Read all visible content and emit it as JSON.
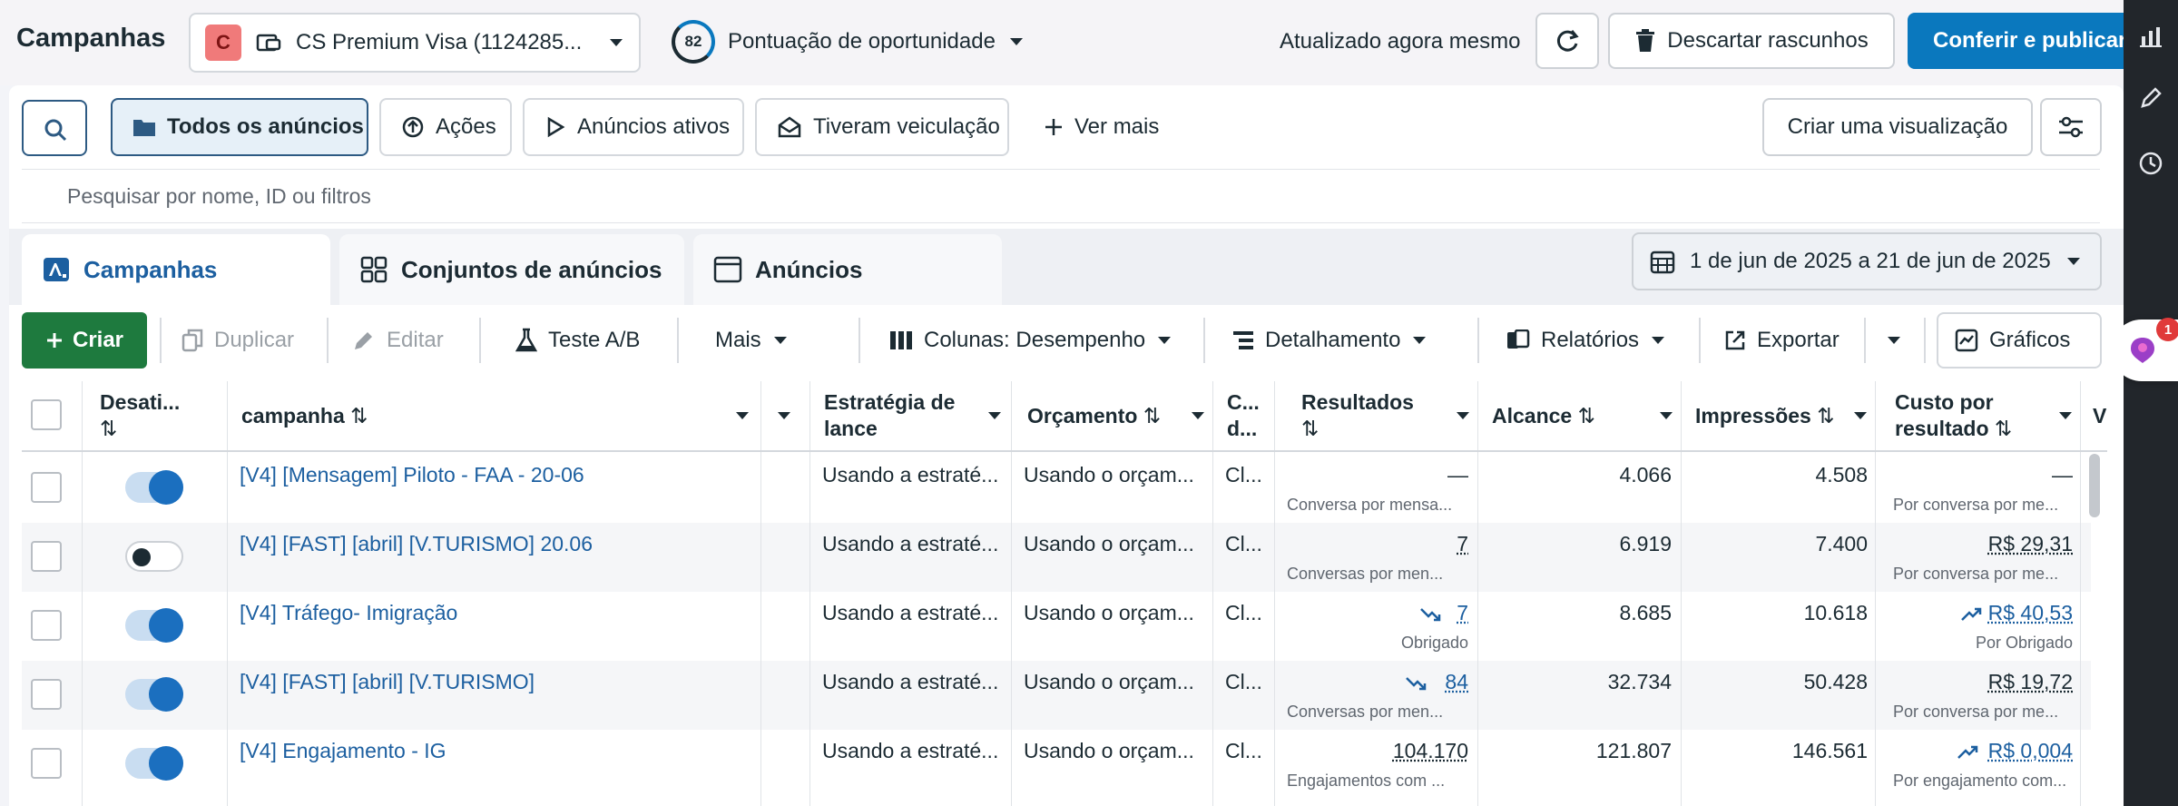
{
  "header": {
    "title": "Campanhas",
    "account": {
      "avatar_letter": "C",
      "name": "CS Premium Visa (1124285..."
    },
    "opportunity": {
      "score": "82",
      "label": "Pontuação de oportunidade"
    },
    "updated": "Atualizado agora mesmo",
    "discard_label": "Descartar rascunhos",
    "publish_label": "Conferir e publicar (",
    "rail_badge": "1"
  },
  "filters": {
    "chips": [
      "Todos os anúncios",
      "Ações",
      "Anúncios ativos",
      "Tiveram veiculação"
    ],
    "more": "Ver mais",
    "create_view": "Criar uma visualização",
    "search_placeholder": "Pesquisar por nome, ID ou filtros"
  },
  "tabs": [
    "Campanhas",
    "Conjuntos de anúncios",
    "Anúncios"
  ],
  "date_range": "1 de jun de 2025 a 21 de jun de 2025",
  "toolbar": {
    "create": "Criar",
    "duplicate": "Duplicar",
    "edit": "Editar",
    "ab_test": "Teste A/B",
    "more": "Mais",
    "columns": "Colunas: Desempenho",
    "breakdown": "Detalhamento",
    "reports": "Relatórios",
    "export": "Exportar",
    "charts": "Gráficos"
  },
  "table": {
    "headers": {
      "toggle": "Desati...",
      "name": "campanha",
      "bid": "Estratégia de lance",
      "budget": "Orçamento",
      "cd": "C... d...",
      "results": "Resultados",
      "reach": "Alcance",
      "impressions": "Impressões",
      "cost": "Custo por resultado",
      "next": "V"
    },
    "rows": [
      {
        "on": true,
        "name": "[V4] [Mensagem] Piloto - FAA - 20-06",
        "bid": "Usando a estraté...",
        "budget": "Usando o orçam...",
        "cd": "Cl...",
        "result": "—",
        "result_sub": "Conversa por mensa...",
        "reach": "4.066",
        "impressions": "4.508",
        "cost": "—",
        "cost_sub": "Por conversa por me..."
      },
      {
        "on": false,
        "name": "[V4] [FAST] [abril] [V.TURISMO] 20.06",
        "bid": "Usando a estraté...",
        "budget": "Usando o orçam...",
        "cd": "Cl...",
        "result": "7",
        "result_sub": "Conversas por men...",
        "reach": "6.919",
        "impressions": "7.400",
        "cost": "R$ 29,31",
        "cost_sub": "Por conversa por me..."
      },
      {
        "on": true,
        "name": "[V4] Tráfego- Imigração",
        "bid": "Usando a estraté...",
        "budget": "Usando o orçam...",
        "cd": "Cl...",
        "result": "7",
        "result_sub": "Obrigado",
        "reach": "8.685",
        "impressions": "10.618",
        "cost": "R$ 40,53",
        "cost_sub": "Por Obrigado"
      },
      {
        "on": true,
        "name": "[V4] [FAST] [abril] [V.TURISMO]",
        "bid": "Usando a estraté...",
        "budget": "Usando o orçam...",
        "cd": "Cl...",
        "result": "84",
        "result_sub": "Conversas por men...",
        "reach": "32.734",
        "impressions": "50.428",
        "cost": "R$ 19,72",
        "cost_sub": "Por conversa por me..."
      },
      {
        "on": true,
        "name": "[V4] Engajamento - IG",
        "bid": "Usando a estraté...",
        "budget": "Usando o orçam...",
        "cd": "Cl...",
        "result": "104.170",
        "result_sub": "Engajamentos com ...",
        "reach": "121.807",
        "impressions": "146.561",
        "cost": "R$ 0,004",
        "cost_sub": "Por engajamento com..."
      }
    ]
  },
  "colors": {
    "primary": "#0a78be",
    "create": "#1e7a3e",
    "link": "#1c5fa0",
    "rail": "#22262b"
  }
}
